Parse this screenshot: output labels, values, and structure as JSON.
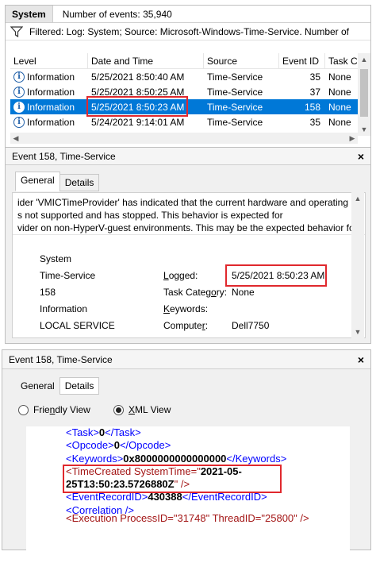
{
  "list_panel": {
    "title": "System",
    "count_label": "Number of events: 35,940",
    "filter_text": "Filtered: Log: System; Source: Microsoft-Windows-Time-Service. Number of",
    "columns": [
      "Level",
      "Date and Time",
      "Source",
      "Event ID",
      "Task Ca"
    ],
    "rows": [
      {
        "level": "Information",
        "date": "5/25/2021 8:50:40 AM",
        "source": "Time-Service",
        "id": "35",
        "task": "None"
      },
      {
        "level": "Information",
        "date": "5/25/2021 8:50:25 AM",
        "source": "Time-Service",
        "id": "37",
        "task": "None"
      },
      {
        "level": "Information",
        "date": "5/25/2021 8:50:23 AM",
        "source": "Time-Service",
        "id": "158",
        "task": "None"
      },
      {
        "level": "Information",
        "date": "5/24/2021 9:14:01 AM",
        "source": "Time-Service",
        "id": "35",
        "task": "None"
      }
    ]
  },
  "general_panel": {
    "title": "Event 158, Time-Service",
    "close": "×",
    "tabs": [
      "General",
      "Details"
    ],
    "description_lines": [
      "ider 'VMICTimeProvider' has indicated that the current hardware and operating",
      "s not supported and has stopped. This behavior is expected for",
      "vider on non-HyperV-guest environments. This may be the expected behavior fo"
    ],
    "left_values": [
      "System",
      "Time-Service",
      "158",
      "Information",
      "LOCAL SERVICE"
    ],
    "fields": [
      {
        "label_pre": "",
        "label_u": "L",
        "label_post": "ogged:",
        "value": "5/25/2021 8:50:23 AM"
      },
      {
        "label_pre": "Task Categ",
        "label_u": "o",
        "label_post": "ry:",
        "value": "None"
      },
      {
        "label_pre": "",
        "label_u": "K",
        "label_post": "eywords:",
        "value": ""
      },
      {
        "label_pre": "Compute",
        "label_u": "r",
        "label_post": ":",
        "value": "Dell7750"
      }
    ]
  },
  "details_panel": {
    "title": "Event 158, Time-Service",
    "close": "×",
    "tabs": [
      "General",
      "Details"
    ],
    "view_friendly_pre": "Frie",
    "view_friendly_u": "n",
    "view_friendly_post": "dly View",
    "view_xml_u": "X",
    "view_xml_post": "ML View",
    "xml": {
      "task_open": "<Task>",
      "task_val": "0",
      "task_close": "</Task>",
      "opcode_open": "<Opcode>",
      "opcode_val": "0",
      "opcode_close": "</Opcode>",
      "keywords_open": "<Keywords>",
      "keywords_val": "0x8000000000000000",
      "keywords_close": "</Keywords>",
      "tc_open": "<TimeCreated SystemTime=\"",
      "tc_val1": "2021-05-",
      "tc_val2": "25T13:50:23.5726880Z",
      "tc_close": "\" />",
      "erid_open": "<EventRecordID>",
      "erid_val": "430388",
      "erid_close": "</EventRecordID>",
      "corr": "<Correlation />",
      "exec_partial": "<Execution ProcessID=\"31748\" ThreadID=\"25800\" />"
    }
  },
  "icons": {
    "info": "i",
    "up": "▲",
    "down": "▼",
    "left": "◀",
    "right": "▶"
  },
  "colors": {
    "selection": "#0078d7",
    "highlight_box": "#e0282d",
    "xml_tag": "#a31515",
    "xml_bracket": "#0000ff"
  }
}
